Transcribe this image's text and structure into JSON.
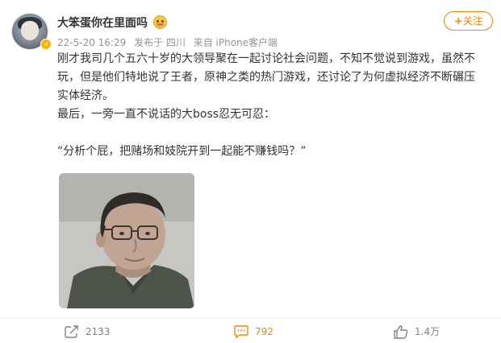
{
  "author": {
    "name": "大笨蛋你在里面吗",
    "emoji": "blush-emoji-icon",
    "verified_badge": "v-icon"
  },
  "meta": {
    "time": "22-5-20 16:29",
    "location": "发布于 四川",
    "source": "来自 iPhone客户端"
  },
  "follow_button": {
    "label": "+关注",
    "plus": "+",
    "text": "关注"
  },
  "post": {
    "paragraph1": "刚才我司几个五六十岁的大领导聚在一起讨论社会问题，不知不觉说到游戏，虽然不玩，但是他们特地说了王者，原神之类的热门游戏，还讨论了为何虚拟经济不断碾压实体经济。",
    "paragraph2": "最后，一旁一直不说话的大boss忍无可忍：",
    "quote": "“分析个屁，把赌场和妓院开到一起能不赚钱吗？”"
  },
  "actions": {
    "repost_count": "2133",
    "comment_count": "792",
    "like_count": "1.4万"
  },
  "colors": {
    "accent": "#ff8200",
    "text": "#333333",
    "meta": "#939393"
  }
}
